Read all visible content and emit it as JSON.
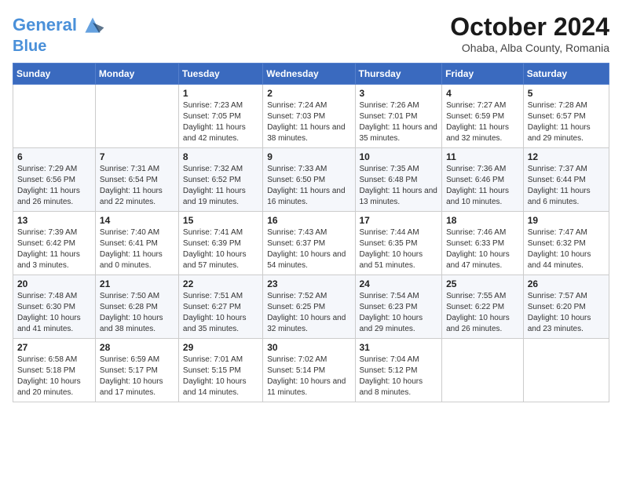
{
  "header": {
    "logo_line1": "General",
    "logo_line2": "Blue",
    "month": "October 2024",
    "location": "Ohaba, Alba County, Romania"
  },
  "weekdays": [
    "Sunday",
    "Monday",
    "Tuesday",
    "Wednesday",
    "Thursday",
    "Friday",
    "Saturday"
  ],
  "weeks": [
    [
      {
        "day": "",
        "info": ""
      },
      {
        "day": "",
        "info": ""
      },
      {
        "day": "1",
        "info": "Sunrise: 7:23 AM\nSunset: 7:05 PM\nDaylight: 11 hours and 42 minutes."
      },
      {
        "day": "2",
        "info": "Sunrise: 7:24 AM\nSunset: 7:03 PM\nDaylight: 11 hours and 38 minutes."
      },
      {
        "day": "3",
        "info": "Sunrise: 7:26 AM\nSunset: 7:01 PM\nDaylight: 11 hours and 35 minutes."
      },
      {
        "day": "4",
        "info": "Sunrise: 7:27 AM\nSunset: 6:59 PM\nDaylight: 11 hours and 32 minutes."
      },
      {
        "day": "5",
        "info": "Sunrise: 7:28 AM\nSunset: 6:57 PM\nDaylight: 11 hours and 29 minutes."
      }
    ],
    [
      {
        "day": "6",
        "info": "Sunrise: 7:29 AM\nSunset: 6:56 PM\nDaylight: 11 hours and 26 minutes."
      },
      {
        "day": "7",
        "info": "Sunrise: 7:31 AM\nSunset: 6:54 PM\nDaylight: 11 hours and 22 minutes."
      },
      {
        "day": "8",
        "info": "Sunrise: 7:32 AM\nSunset: 6:52 PM\nDaylight: 11 hours and 19 minutes."
      },
      {
        "day": "9",
        "info": "Sunrise: 7:33 AM\nSunset: 6:50 PM\nDaylight: 11 hours and 16 minutes."
      },
      {
        "day": "10",
        "info": "Sunrise: 7:35 AM\nSunset: 6:48 PM\nDaylight: 11 hours and 13 minutes."
      },
      {
        "day": "11",
        "info": "Sunrise: 7:36 AM\nSunset: 6:46 PM\nDaylight: 11 hours and 10 minutes."
      },
      {
        "day": "12",
        "info": "Sunrise: 7:37 AM\nSunset: 6:44 PM\nDaylight: 11 hours and 6 minutes."
      }
    ],
    [
      {
        "day": "13",
        "info": "Sunrise: 7:39 AM\nSunset: 6:42 PM\nDaylight: 11 hours and 3 minutes."
      },
      {
        "day": "14",
        "info": "Sunrise: 7:40 AM\nSunset: 6:41 PM\nDaylight: 11 hours and 0 minutes."
      },
      {
        "day": "15",
        "info": "Sunrise: 7:41 AM\nSunset: 6:39 PM\nDaylight: 10 hours and 57 minutes."
      },
      {
        "day": "16",
        "info": "Sunrise: 7:43 AM\nSunset: 6:37 PM\nDaylight: 10 hours and 54 minutes."
      },
      {
        "day": "17",
        "info": "Sunrise: 7:44 AM\nSunset: 6:35 PM\nDaylight: 10 hours and 51 minutes."
      },
      {
        "day": "18",
        "info": "Sunrise: 7:46 AM\nSunset: 6:33 PM\nDaylight: 10 hours and 47 minutes."
      },
      {
        "day": "19",
        "info": "Sunrise: 7:47 AM\nSunset: 6:32 PM\nDaylight: 10 hours and 44 minutes."
      }
    ],
    [
      {
        "day": "20",
        "info": "Sunrise: 7:48 AM\nSunset: 6:30 PM\nDaylight: 10 hours and 41 minutes."
      },
      {
        "day": "21",
        "info": "Sunrise: 7:50 AM\nSunset: 6:28 PM\nDaylight: 10 hours and 38 minutes."
      },
      {
        "day": "22",
        "info": "Sunrise: 7:51 AM\nSunset: 6:27 PM\nDaylight: 10 hours and 35 minutes."
      },
      {
        "day": "23",
        "info": "Sunrise: 7:52 AM\nSunset: 6:25 PM\nDaylight: 10 hours and 32 minutes."
      },
      {
        "day": "24",
        "info": "Sunrise: 7:54 AM\nSunset: 6:23 PM\nDaylight: 10 hours and 29 minutes."
      },
      {
        "day": "25",
        "info": "Sunrise: 7:55 AM\nSunset: 6:22 PM\nDaylight: 10 hours and 26 minutes."
      },
      {
        "day": "26",
        "info": "Sunrise: 7:57 AM\nSunset: 6:20 PM\nDaylight: 10 hours and 23 minutes."
      }
    ],
    [
      {
        "day": "27",
        "info": "Sunrise: 6:58 AM\nSunset: 5:18 PM\nDaylight: 10 hours and 20 minutes."
      },
      {
        "day": "28",
        "info": "Sunrise: 6:59 AM\nSunset: 5:17 PM\nDaylight: 10 hours and 17 minutes."
      },
      {
        "day": "29",
        "info": "Sunrise: 7:01 AM\nSunset: 5:15 PM\nDaylight: 10 hours and 14 minutes."
      },
      {
        "day": "30",
        "info": "Sunrise: 7:02 AM\nSunset: 5:14 PM\nDaylight: 10 hours and 11 minutes."
      },
      {
        "day": "31",
        "info": "Sunrise: 7:04 AM\nSunset: 5:12 PM\nDaylight: 10 hours and 8 minutes."
      },
      {
        "day": "",
        "info": ""
      },
      {
        "day": "",
        "info": ""
      }
    ]
  ]
}
